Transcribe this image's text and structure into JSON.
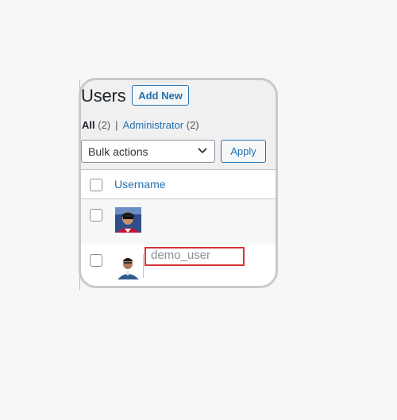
{
  "page": {
    "title": "Users",
    "add_new_label": "Add New"
  },
  "filters": {
    "all_label": "All",
    "all_count": "(2)",
    "separator": "|",
    "admin_label": "Administrator",
    "admin_count": "(2)"
  },
  "bulk_actions": {
    "selected": "Bulk actions",
    "apply_label": "Apply"
  },
  "table": {
    "columns": [
      "Username"
    ],
    "rows": [
      {
        "username": "",
        "avatar": "profile-photo-red-shirt"
      },
      {
        "username": "demo_user",
        "avatar": "profile-photo-blue-shirt"
      }
    ]
  },
  "colors": {
    "accent": "#2271b1",
    "highlight": "#d63638"
  }
}
